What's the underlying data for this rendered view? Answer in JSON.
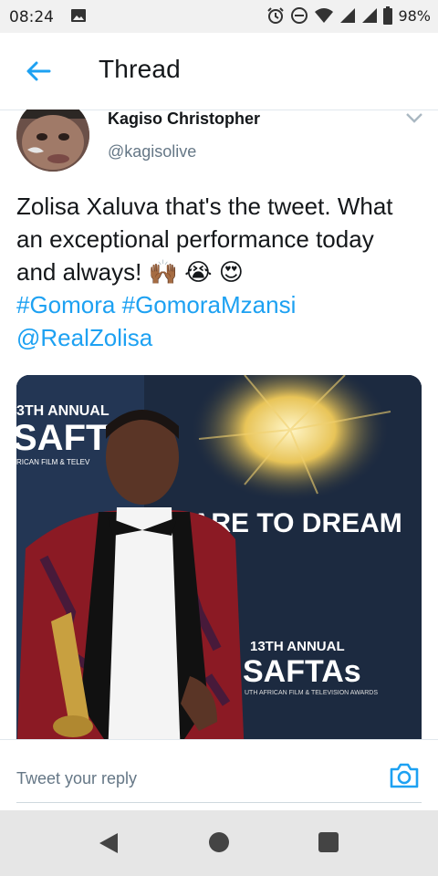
{
  "status_bar": {
    "time": "08:24",
    "battery": "98%"
  },
  "header": {
    "title": "Thread"
  },
  "tweet": {
    "author_name": "Kagiso Christopher",
    "handle": "@kagisolive",
    "text_line1": "Zolisa Xaluva that's the tweet. What",
    "text_line2": "an exceptional performance today",
    "text_line3_prefix": "and always! ",
    "emojis": "🙌🏾 😭 😍",
    "hashtag1": "#Gomora",
    "hashtag2": "#GomoraMzansi",
    "mention": "@RealZolisa",
    "image": {
      "banner_left_year": "3TH ANNUAL",
      "banner_left_text": "SAFT",
      "banner_left_sub": "RICAN FILM & TELEV",
      "slogan": "DARE TO DREAM",
      "banner_right_year": "13TH ANNUAL",
      "banner_right_text": "SAFTAs",
      "banner_right_sub": "UTH AFRICAN FILM & TELEVISION AWARDS"
    }
  },
  "reply": {
    "placeholder": "Tweet your reply"
  },
  "colors": {
    "link": "#1da1f2",
    "text": "#14171a",
    "muted": "#657786"
  },
  "icons": [
    "back-arrow-icon",
    "chevron-down-icon",
    "camera-icon",
    "nav-back-icon",
    "nav-home-icon",
    "nav-recents-icon",
    "alarm-icon",
    "dnd-icon",
    "wifi-icon",
    "signal-icon",
    "battery-icon",
    "gallery-icon"
  ]
}
